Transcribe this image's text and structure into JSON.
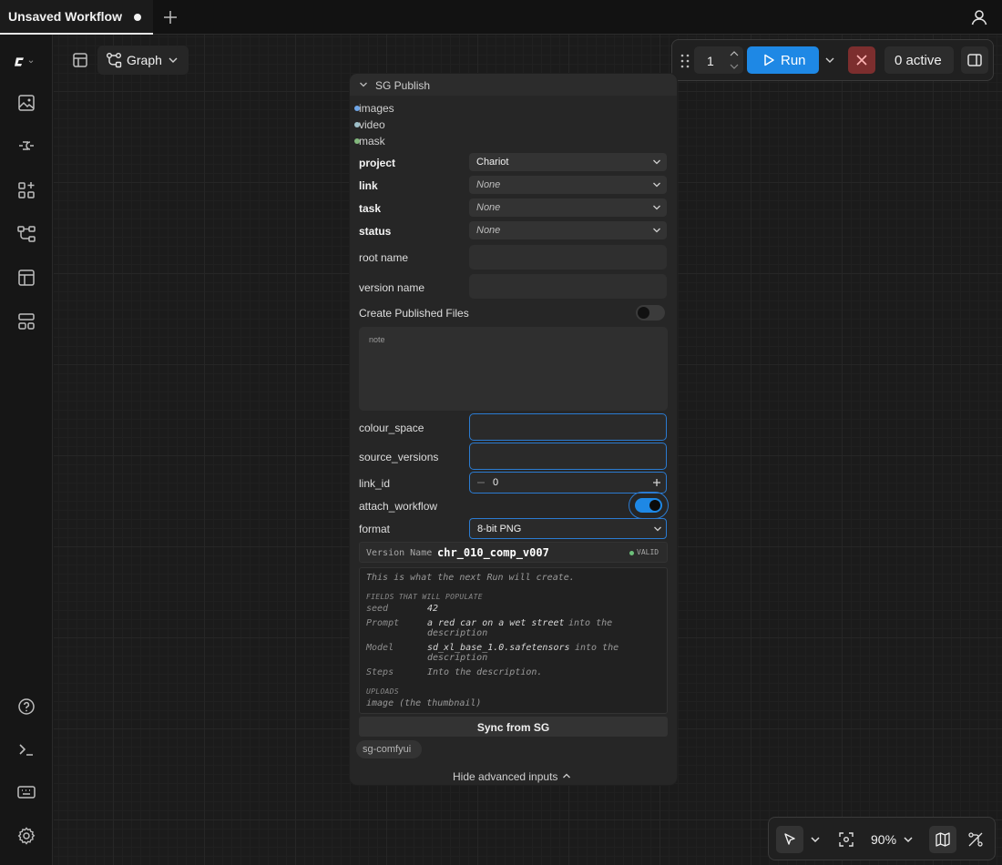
{
  "tabs": {
    "active_title": "Unsaved Workflow"
  },
  "toolbar": {
    "graph_label": "Graph"
  },
  "run_toolbar": {
    "batch_count": "1",
    "run_label": "Run",
    "active_label": "0 active"
  },
  "node": {
    "title": "SG Publish",
    "slots": [
      {
        "label": "images",
        "color": "#6fa6e8"
      },
      {
        "label": "video",
        "color": "#9fc0c9"
      },
      {
        "label": "mask",
        "color": "#82b87c"
      }
    ],
    "widgets": {
      "project": {
        "label": "project",
        "value": "Chariot"
      },
      "link": {
        "label": "link",
        "value": "None"
      },
      "task": {
        "label": "task",
        "value": "None"
      },
      "status": {
        "label": "status",
        "value": "None"
      },
      "root_name": {
        "label": "root name",
        "value": ""
      },
      "version_name": {
        "label": "version name",
        "value": ""
      },
      "create_published_files": {
        "label": "Create Published Files"
      },
      "note": {
        "placeholder": "note"
      },
      "colour_space": {
        "label": "colour_space",
        "value": ""
      },
      "source_versions": {
        "label": "source_versions",
        "value": ""
      },
      "link_id": {
        "label": "link_id",
        "value": "0"
      },
      "attach_workflow": {
        "label": "attach_workflow"
      },
      "format": {
        "label": "format",
        "value": "8-bit PNG"
      }
    },
    "version": {
      "label": "Version Name",
      "value": "chr_010_comp_v007",
      "status": "VALID"
    },
    "info": {
      "intro": "This is what the next Run will create.",
      "fields_heading": "FIELDS THAT WILL POPULATE",
      "fields": [
        {
          "key": "seed",
          "value": "42",
          "suffix": ""
        },
        {
          "key": "Prompt",
          "value": "a red car on a wet street",
          "suffix": "into the",
          "suffix2": "description"
        },
        {
          "key": "Model",
          "value": "sd_xl_base_1.0.safetensors",
          "suffix": "into the",
          "suffix2": "description"
        },
        {
          "key": "Steps",
          "value": "",
          "suffix": "Into the description."
        }
      ],
      "uploads_heading": "UPLOADS",
      "uploads": "image (the thumbnail)"
    },
    "sync_label": "Sync from SG",
    "badge": "sg-comfyui",
    "hide_label": "Hide advanced inputs"
  },
  "bottom": {
    "zoom": "90%"
  },
  "colors": {
    "accent": "#1e88e5",
    "stop": "#7c2e2e",
    "valid": "#6cc07a"
  }
}
